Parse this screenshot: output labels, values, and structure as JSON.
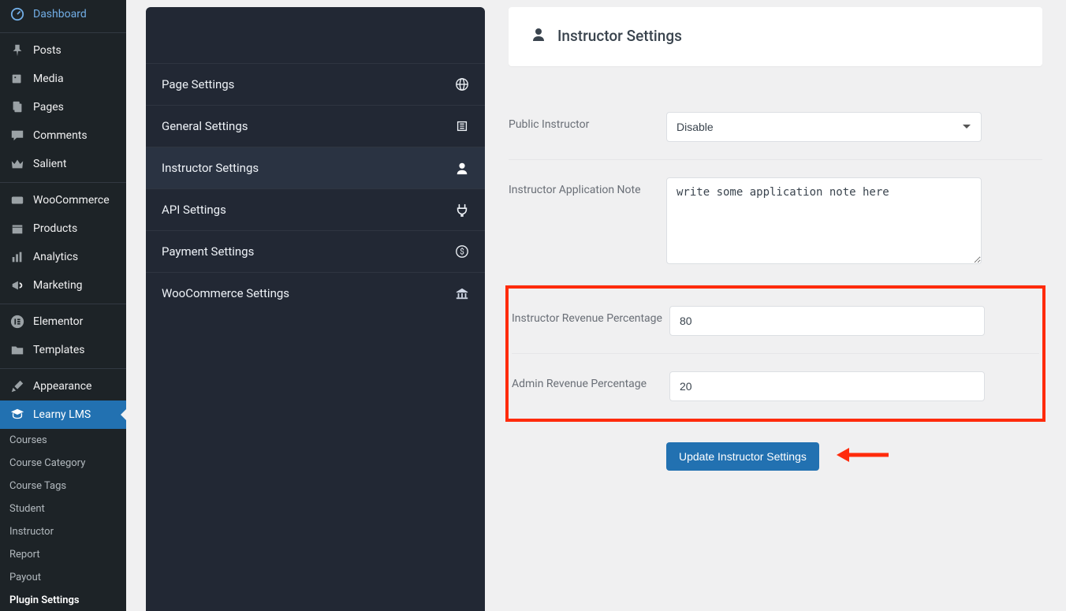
{
  "wp_nav": [
    {
      "id": "dashboard",
      "label": "Dashboard",
      "icon": "dashboard"
    },
    {
      "id": "sep1",
      "separator": true
    },
    {
      "id": "posts",
      "label": "Posts",
      "icon": "pin"
    },
    {
      "id": "media",
      "label": "Media",
      "icon": "media"
    },
    {
      "id": "pages",
      "label": "Pages",
      "icon": "page"
    },
    {
      "id": "comments",
      "label": "Comments",
      "icon": "comment"
    },
    {
      "id": "salient",
      "label": "Salient",
      "icon": "crown"
    },
    {
      "id": "sep2",
      "separator": true
    },
    {
      "id": "woocommerce",
      "label": "WooCommerce",
      "icon": "woo"
    },
    {
      "id": "products",
      "label": "Products",
      "icon": "box"
    },
    {
      "id": "analytics",
      "label": "Analytics",
      "icon": "bars"
    },
    {
      "id": "marketing",
      "label": "Marketing",
      "icon": "megaphone"
    },
    {
      "id": "sep3",
      "separator": true
    },
    {
      "id": "elementor",
      "label": "Elementor",
      "icon": "elementor"
    },
    {
      "id": "templates",
      "label": "Templates",
      "icon": "folder"
    },
    {
      "id": "sep4",
      "separator": true
    },
    {
      "id": "appearance",
      "label": "Appearance",
      "icon": "brush"
    },
    {
      "id": "learny",
      "label": "Learny LMS",
      "icon": "grad",
      "selected": true
    }
  ],
  "learny_sub": [
    {
      "id": "courses",
      "label": "Courses"
    },
    {
      "id": "course-category",
      "label": "Course Category"
    },
    {
      "id": "course-tags",
      "label": "Course Tags"
    },
    {
      "id": "student",
      "label": "Student"
    },
    {
      "id": "instructor",
      "label": "Instructor"
    },
    {
      "id": "report",
      "label": "Report"
    },
    {
      "id": "payout",
      "label": "Payout"
    },
    {
      "id": "plugin-settings",
      "label": "Plugin Settings",
      "active": true
    }
  ],
  "settings_tabs": [
    {
      "id": "page",
      "label": "Page Settings",
      "icon": "globe"
    },
    {
      "id": "general",
      "label": "General Settings",
      "icon": "sliders"
    },
    {
      "id": "instructor",
      "label": "Instructor Settings",
      "icon": "user",
      "active": true
    },
    {
      "id": "api",
      "label": "API Settings",
      "icon": "plug"
    },
    {
      "id": "payment",
      "label": "Payment Settings",
      "icon": "dollar"
    },
    {
      "id": "woocommerce",
      "label": "WooCommerce Settings",
      "icon": "bank"
    }
  ],
  "page_title": "Instructor Settings",
  "fields": {
    "public_instructor": {
      "label": "Public Instructor",
      "value": "Disable"
    },
    "application_note": {
      "label": "Instructor Application Note",
      "value": "write some application note here"
    },
    "instructor_revenue": {
      "label": "Instructor Revenue Percentage",
      "value": "80"
    },
    "admin_revenue": {
      "label": "Admin Revenue Percentage",
      "value": "20"
    }
  },
  "submit_label": "Update Instructor Settings"
}
